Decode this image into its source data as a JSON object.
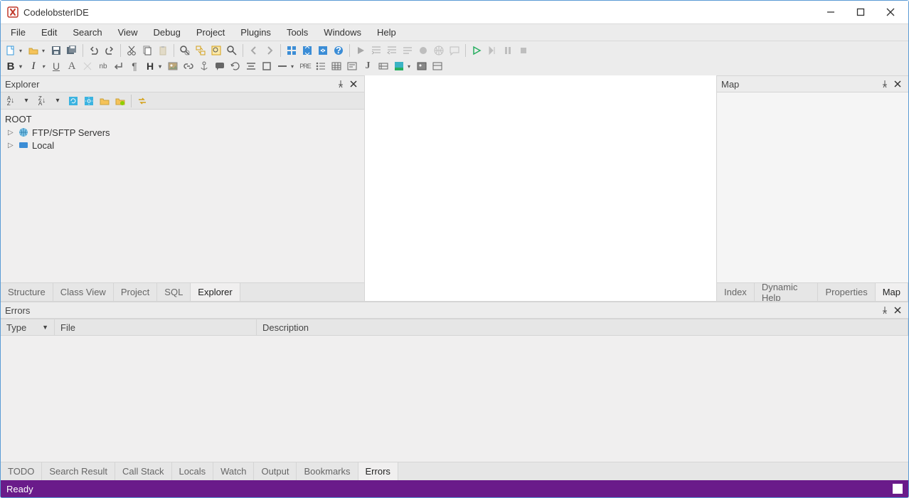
{
  "app": {
    "title": "CodelobsterIDE"
  },
  "menu": {
    "items": [
      "File",
      "Edit",
      "Search",
      "View",
      "Debug",
      "Project",
      "Plugins",
      "Tools",
      "Windows",
      "Help"
    ]
  },
  "explorer": {
    "title": "Explorer",
    "root_label": "ROOT",
    "nodes": [
      {
        "label": "FTP/SFTP Servers"
      },
      {
        "label": "Local"
      }
    ]
  },
  "left_tabs": [
    "Structure",
    "Class View",
    "Project",
    "SQL",
    "Explorer"
  ],
  "left_tabs_active": "Explorer",
  "map": {
    "title": "Map"
  },
  "right_tabs": [
    "Index",
    "Dynamic Help",
    "Properties",
    "Map"
  ],
  "right_tabs_active": "Map",
  "errors": {
    "title": "Errors",
    "columns": {
      "type": "Type",
      "file": "File",
      "description": "Description"
    }
  },
  "bottom_tabs": [
    "TODO",
    "Search Result",
    "Call Stack",
    "Locals",
    "Watch",
    "Output",
    "Bookmarks",
    "Errors"
  ],
  "bottom_tabs_active": "Errors",
  "status": {
    "text": "Ready"
  }
}
